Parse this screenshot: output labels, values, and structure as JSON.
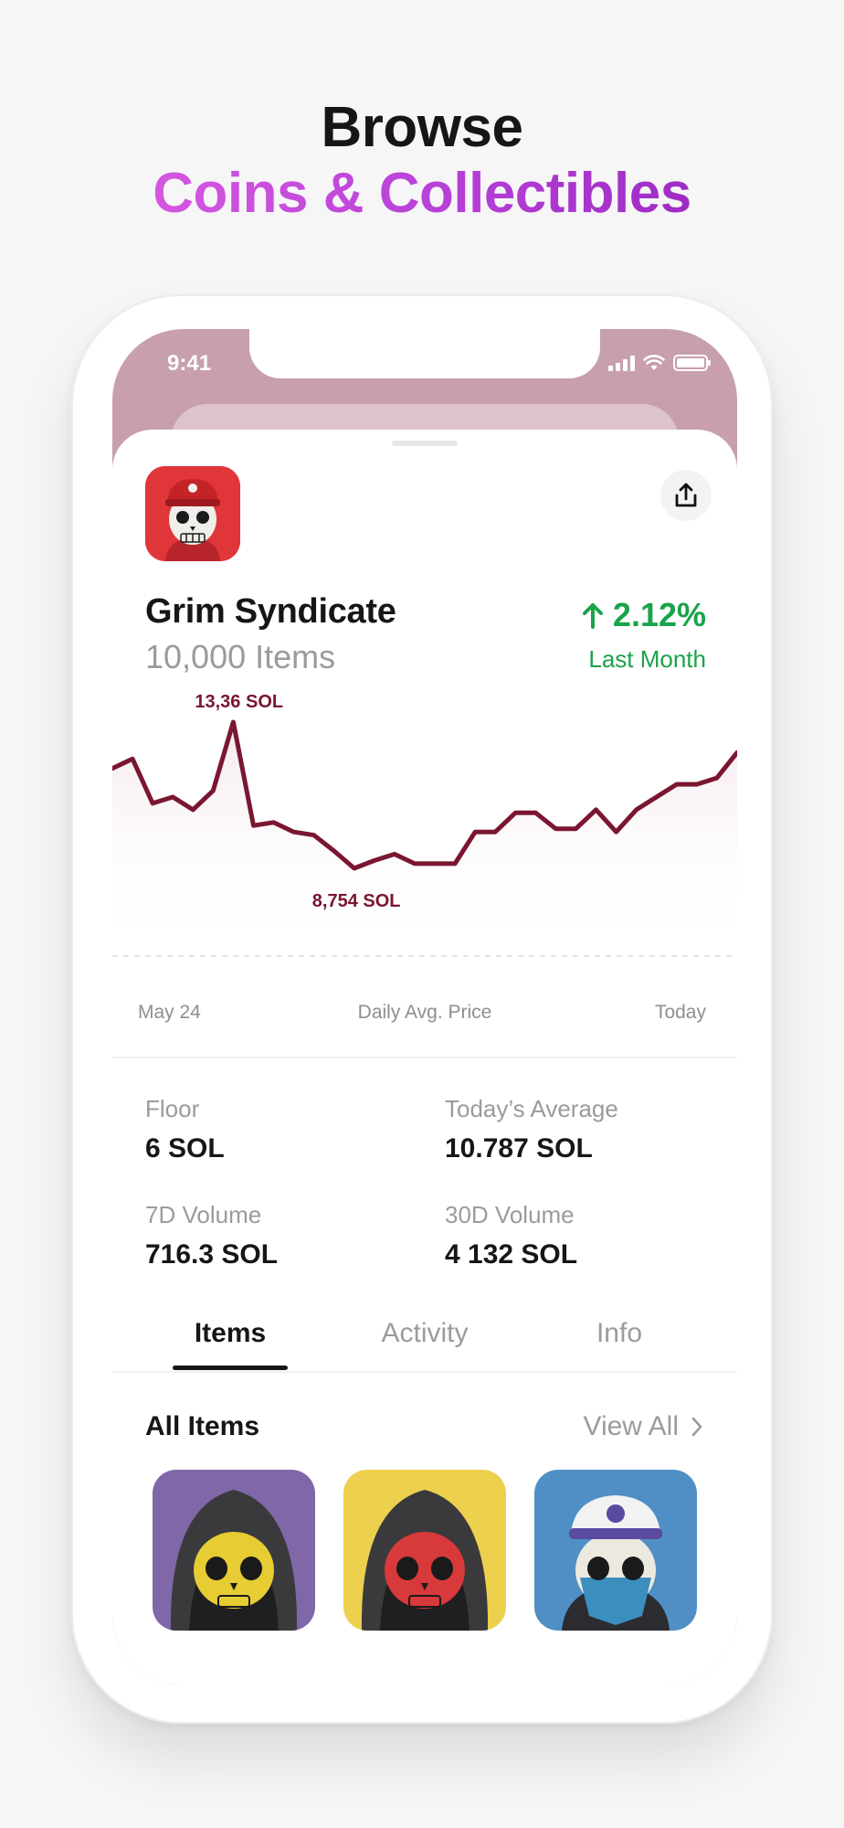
{
  "headline": {
    "line1": "Browse",
    "line2": "Coins & Collectibles"
  },
  "status_bar": {
    "time": "9:41"
  },
  "collection": {
    "name": "Grim Syndicate",
    "items_count": "10,000 Items",
    "change": "2.12%",
    "change_period": "Last Month"
  },
  "chart_data": {
    "type": "line",
    "title": "Daily Avg. Price",
    "x_start_label": "May 24",
    "x_end_label": "Today",
    "high_label": "13,36 SOL",
    "low_label": "8,754 SOL",
    "values": [
      11.9,
      12.2,
      10.8,
      11.0,
      10.6,
      11.2,
      13.36,
      10.1,
      10.2,
      9.9,
      9.8,
      9.3,
      8.754,
      9.0,
      9.2,
      8.9,
      8.9,
      8.9,
      9.9,
      9.9,
      10.5,
      10.5,
      10.0,
      10.0,
      10.6,
      9.9,
      10.6,
      11.0,
      11.4,
      11.4,
      11.6,
      12.4
    ],
    "color": "#7a1630",
    "fill_color": "#f3e7eb"
  },
  "stats": {
    "floor_label": "Floor",
    "floor_value": "6 SOL",
    "avg_label": "Today’s Average",
    "avg_value": "10.787 SOL",
    "vol7_label": "7D Volume",
    "vol7_value": "716.3 SOL",
    "vol30_label": "30D Volume",
    "vol30_value": "4 132 SOL"
  },
  "tabs": [
    {
      "label": "Items",
      "active": true
    },
    {
      "label": "Activity",
      "active": false
    },
    {
      "label": "Info",
      "active": false
    }
  ],
  "items_section": {
    "title": "All Items",
    "view_all": "View All"
  },
  "nft_items": [
    {
      "bg": "#7f67a8",
      "skull": "#e7cc33",
      "hood": "#3a3a3c"
    },
    {
      "bg": "#ecd04e",
      "skull": "#d8393a",
      "hood": "#3a3a3c"
    },
    {
      "bg": "#4f8fc5",
      "skull": "#ece9e0",
      "hood": "#3a3a3c"
    }
  ],
  "colors": {
    "accent_green": "#1aa34a",
    "chart_line": "#7a1630",
    "screen_top": "#c89fac"
  }
}
